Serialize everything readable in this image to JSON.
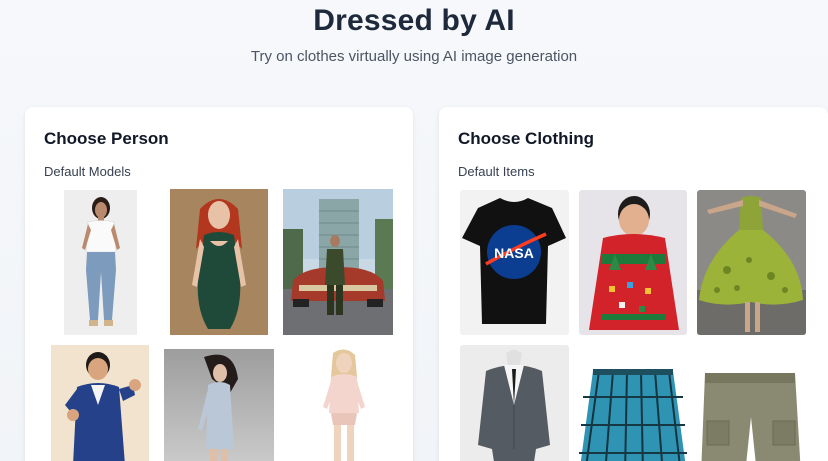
{
  "header": {
    "title": "Dressed by AI",
    "subtitle": "Try on clothes virtually using AI image generation"
  },
  "person_panel": {
    "title": "Choose Person",
    "section_label": "Default Models",
    "models": [
      {
        "icon": "person-white-tee-jeans-photo"
      },
      {
        "icon": "person-red-hair-green-dress-photo"
      },
      {
        "icon": "person-car-building-photo"
      },
      {
        "icon": "person-blue-suit-photo"
      },
      {
        "icon": "person-windblown-hair-photo"
      },
      {
        "icon": "person-pink-top-photo"
      }
    ]
  },
  "clothing_panel": {
    "title": "Choose Clothing",
    "section_label": "Default Items",
    "items": [
      {
        "icon": "black-tshirt-photo",
        "logo_text": "NASA"
      },
      {
        "icon": "red-christmas-sweater-photo"
      },
      {
        "icon": "green-dress-photo"
      },
      {
        "icon": "grey-suit-photo"
      },
      {
        "icon": "plaid-skirt-photo"
      },
      {
        "icon": "cargo-shorts-photo"
      }
    ]
  },
  "colors": {
    "background": "#f3f5f8",
    "card": "#ffffff",
    "title": "#1e293b",
    "nasa_blue": "#0b3d91",
    "nasa_red": "#fc3d21"
  }
}
